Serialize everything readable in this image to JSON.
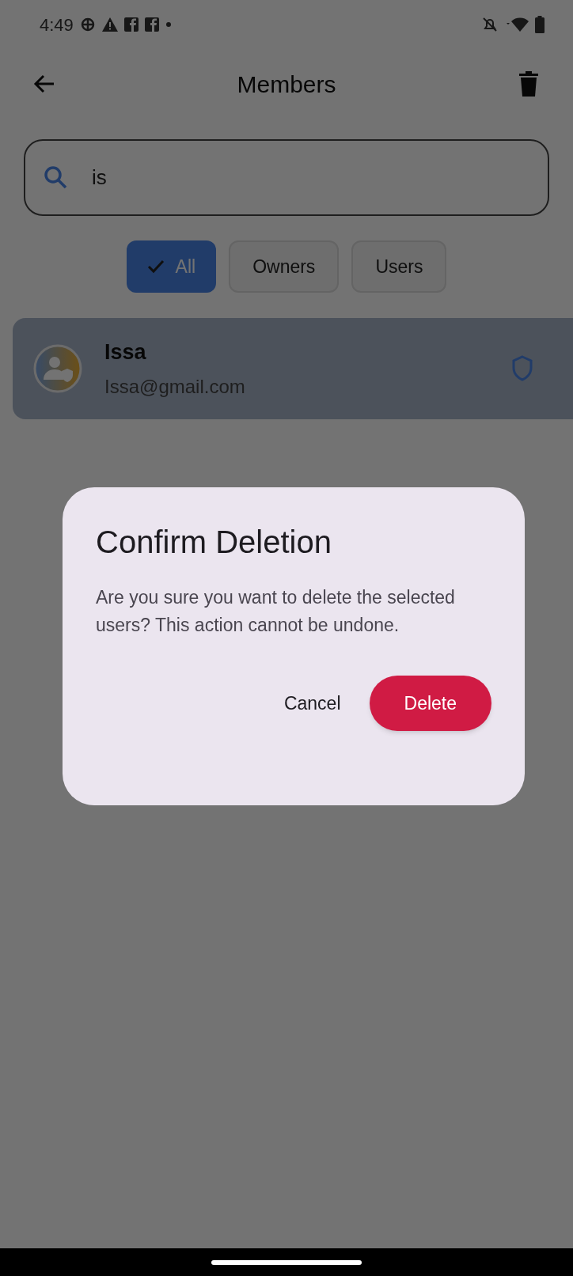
{
  "status_bar": {
    "time": "4:49"
  },
  "app_bar": {
    "title": "Members"
  },
  "search": {
    "value": "is"
  },
  "filters": [
    {
      "label": "All",
      "selected": true
    },
    {
      "label": "Owners",
      "selected": false
    },
    {
      "label": "Users",
      "selected": false
    }
  ],
  "members": [
    {
      "name": "Issa",
      "email": "Issa@gmail.com",
      "selected": true
    }
  ],
  "dialog": {
    "title": "Confirm Deletion",
    "message": "Are you sure you want to delete the selected users? This action cannot be undone.",
    "buttons": [
      {
        "label": "Cancel",
        "kind": "text"
      },
      {
        "label": "Delete",
        "kind": "filled"
      }
    ]
  }
}
